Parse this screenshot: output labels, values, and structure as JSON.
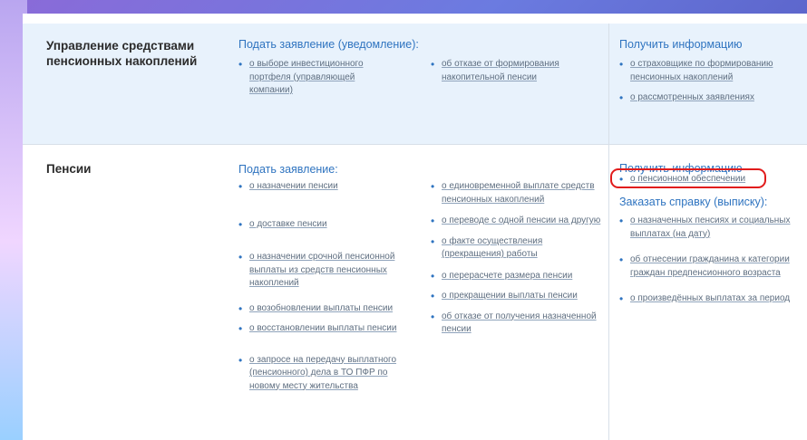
{
  "sections": [
    {
      "title": "Управление средствами пенсионных накоплений",
      "apply": {
        "heading": "Подать заявление (уведомление):",
        "col1": [
          "о выборе инвестиционного портфеля (управляющей компании)"
        ],
        "col2": [
          "об отказе от формирования накопительной пенсии"
        ]
      },
      "info": {
        "heading": "Получить информацию",
        "items": [
          "о страховщике по формированию пенсионных накоплений",
          "о рассмотренных заявлениях"
        ]
      }
    },
    {
      "title": "Пенсии",
      "apply": {
        "heading": "Подать заявление:",
        "col1": [
          "о назначении пенсии",
          "о доставке пенсии",
          "о назначении срочной пенсионной выплаты из средств пенсионных накоплений",
          "о возобновлении выплаты пенсии",
          "о восстановлении выплаты пенсии",
          "о запросе на передачу выплатного (пенсионного) дела в ТО ПФР по новому месту жительства"
        ],
        "col2": [
          "о единовременной выплате средств пенсионных накоплений",
          "о переводе с одной пенсии на другую",
          "о факте осуществления (прекращения) работы",
          "о перерасчете размера пенсии",
          "о прекращении выплаты пенсии",
          "об отказе от получения назначенной пенсии"
        ]
      },
      "info": {
        "heading": "Получить информацию",
        "items": [
          "о пенсионном обеспечении"
        ]
      },
      "certificate": {
        "heading": "Заказать справку (выписку):",
        "items": [
          "о назначенных пенсиях и социальных выплатах (на дату)",
          "об отнесении гражданина к категории граждан предпенсионного возраста",
          "о произведённых выплатах за период"
        ]
      }
    }
  ],
  "highlight_color": "#e11c1c",
  "link_color": "#2f74c0"
}
